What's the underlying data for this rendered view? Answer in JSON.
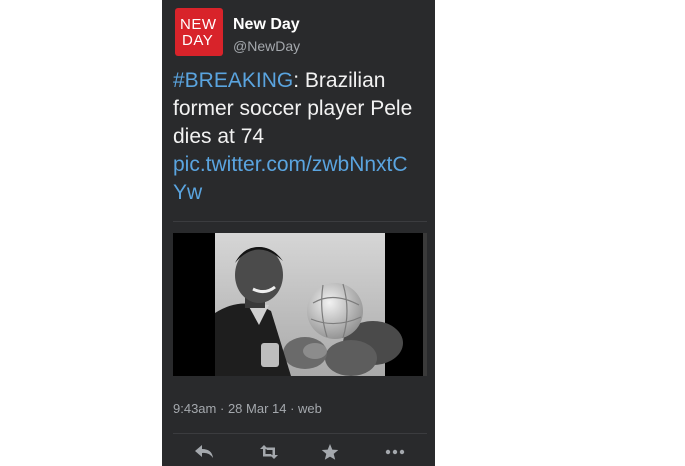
{
  "account": {
    "avatar_line1": "NEW",
    "avatar_line2": "DAY",
    "display_name": "New Day",
    "handle": "@NewDay"
  },
  "tweet": {
    "hashtag": "#BREAKING",
    "text": ": Brazilian former soccer player Pele dies at 74",
    "link_line1": "pic.twitter.com/zwbNnxtC",
    "link_line2": "Yw"
  },
  "meta": {
    "time": "9:43am",
    "separator1": " · ",
    "date": "28 Mar 14",
    "separator2": " · ",
    "source": "web"
  },
  "actions": [
    {
      "name": "reply",
      "icon": "reply-icon"
    },
    {
      "name": "retweet",
      "icon": "retweet-icon"
    },
    {
      "name": "favorite",
      "icon": "star-icon"
    },
    {
      "name": "more",
      "icon": "more-icon"
    }
  ],
  "colors": {
    "background": "#292a2c",
    "link": "#5aa4df",
    "avatar": "#d8232a",
    "muted": "#a4a8ad"
  }
}
